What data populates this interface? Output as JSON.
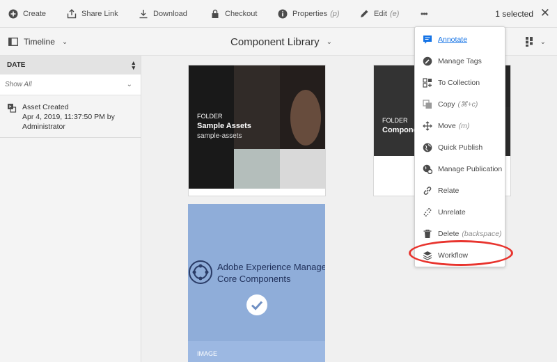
{
  "actionbar": {
    "create": "Create",
    "share_link": "Share Link",
    "download": "Download",
    "checkout": "Checkout",
    "properties": "Properties",
    "properties_shortcut": "(p)",
    "edit": "Edit",
    "edit_shortcut": "(e)",
    "more": "•••",
    "selected_count": "1 selected",
    "close": "✕"
  },
  "header": {
    "rail_toggle": "Timeline",
    "title": "Component Library"
  },
  "rail": {
    "header": "DATE",
    "filter": "Show All",
    "events": [
      {
        "line1": "Asset Created",
        "line2": "Apr 4, 2019, 11:37:50 PM by",
        "line3": "Administrator"
      }
    ]
  },
  "cards": [
    {
      "type": "FOLDER",
      "title": "Sample Assets",
      "subtitle": "sample-assets"
    },
    {
      "type": "FOLDER",
      "title": "Componer",
      "subtitle": ""
    },
    {
      "type": "IMAGE",
      "title_line1": "Adobe Experience Manager",
      "title_line2": "Core Components"
    }
  ],
  "menu": [
    {
      "label": "Annotate",
      "shortcut": "",
      "icon": "annotate-icon",
      "active": true
    },
    {
      "label": "Manage Tags",
      "shortcut": "",
      "icon": "tag-icon"
    },
    {
      "label": "To Collection",
      "shortcut": "",
      "icon": "collection-icon"
    },
    {
      "label": "Copy",
      "shortcut": "(⌘+c)",
      "icon": "copy-icon"
    },
    {
      "label": "Move",
      "shortcut": "(m)",
      "icon": "move-icon"
    },
    {
      "label": "Quick Publish",
      "shortcut": "",
      "icon": "globe-icon"
    },
    {
      "label": "Manage Publication",
      "shortcut": "",
      "icon": "globe-settings-icon"
    },
    {
      "label": "Relate",
      "shortcut": "",
      "icon": "link-icon"
    },
    {
      "label": "Unrelate",
      "shortcut": "",
      "icon": "unlink-icon"
    },
    {
      "label": "Delete",
      "shortcut": "(backspace)",
      "icon": "trash-icon"
    },
    {
      "label": "Workflow",
      "shortcut": "",
      "icon": "workflow-icon"
    }
  ],
  "colors": {
    "accent": "#1473e6",
    "highlight_ring": "#e8342e",
    "selected_card": "#8fadd9",
    "check": "#ffffff"
  }
}
